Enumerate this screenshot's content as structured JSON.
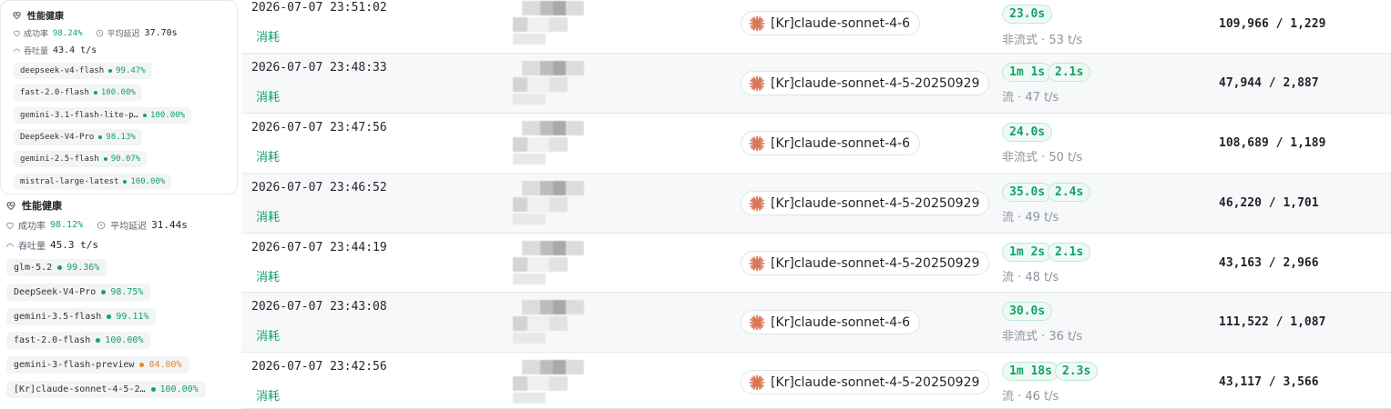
{
  "panel_top": {
    "title": "性能健康",
    "success_label": "成功率",
    "success_value": "98.24%",
    "latency_label": "平均延迟",
    "latency_value": "37.70s",
    "throughput_label": "吞吐量",
    "throughput_value": "43.4 t/s",
    "models": [
      {
        "name": "deepseek-v4-flash",
        "pct": "99.47%"
      },
      {
        "name": "fast-2.0-flash",
        "pct": "100.00%"
      },
      {
        "name": "gemini-3.1-flash-lite-p…",
        "pct": "100.00%"
      },
      {
        "name": "DeepSeek-V4-Pro",
        "pct": "98.13%"
      },
      {
        "name": "gemini-2.5-flash",
        "pct": "90.07%"
      },
      {
        "name": "mistral-large-latest",
        "pct": "100.00%"
      }
    ]
  },
  "panel_bottom": {
    "title": "性能健康",
    "success_label": "成功率",
    "success_value": "98.12%",
    "latency_label": "平均延迟",
    "latency_value": "31.44s",
    "throughput_label": "吞吐量",
    "throughput_value": "45.3 t/s",
    "models": [
      {
        "name": "glm-5.2",
        "pct": "99.36%",
        "status": "green"
      },
      {
        "name": "DeepSeek-V4-Pro",
        "pct": "98.75%",
        "status": "green"
      },
      {
        "name": "gemini-3.5-flash",
        "pct": "99.11%",
        "status": "green"
      },
      {
        "name": "fast-2.0-flash",
        "pct": "100.00%",
        "status": "green"
      },
      {
        "name": "gemini-3-flash-preview",
        "pct": "84.00%",
        "status": "orange"
      },
      {
        "name": "[Kr]claude-sonnet-4-5-2…",
        "pct": "100.00%",
        "status": "green"
      }
    ]
  },
  "rows": [
    {
      "time": "2026-07-07 23:51:02",
      "type": "消耗",
      "model": "[Kr]claude-sonnet-4-6",
      "duration": "23.0s",
      "first_token": "",
      "speed": "非流式 · 53 t/s",
      "tokens": "109,966 / 1,229"
    },
    {
      "time": "2026-07-07 23:48:33",
      "type": "消耗",
      "model": "[Kr]claude-sonnet-4-5-20250929",
      "duration": "1m 1s",
      "first_token": "2.1s",
      "speed": "流 · 47 t/s",
      "tokens": "47,944 / 2,887"
    },
    {
      "time": "2026-07-07 23:47:56",
      "type": "消耗",
      "model": "[Kr]claude-sonnet-4-6",
      "duration": "24.0s",
      "first_token": "",
      "speed": "非流式 · 50 t/s",
      "tokens": "108,689 / 1,189"
    },
    {
      "time": "2026-07-07 23:46:52",
      "type": "消耗",
      "model": "[Kr]claude-sonnet-4-5-20250929",
      "duration": "35.0s",
      "first_token": "2.4s",
      "speed": "流 · 49 t/s",
      "tokens": "46,220 / 1,701"
    },
    {
      "time": "2026-07-07 23:44:19",
      "type": "消耗",
      "model": "[Kr]claude-sonnet-4-5-20250929",
      "duration": "1m 2s",
      "first_token": "2.1s",
      "speed": "流 · 48 t/s",
      "tokens": "43,163 / 2,966"
    },
    {
      "time": "2026-07-07 23:43:08",
      "type": "消耗",
      "model": "[Kr]claude-sonnet-4-6",
      "duration": "30.0s",
      "first_token": "",
      "speed": "非流式 · 36 t/s",
      "tokens": "111,522 / 1,087"
    },
    {
      "time": "2026-07-07 23:42:56",
      "type": "消耗",
      "model": "[Kr]claude-sonnet-4-5-20250929",
      "duration": "1m 18s",
      "first_token": "2.3s",
      "speed": "流 · 46 t/s",
      "tokens": "43,117 / 3,566"
    }
  ],
  "colors": {
    "green": "#14a06b",
    "orange": "#e08a2a",
    "brand": "#d97757"
  },
  "icons": [
    "heart-pulse-icon",
    "clock-icon",
    "gauge-icon",
    "claude-logo-icon"
  ]
}
